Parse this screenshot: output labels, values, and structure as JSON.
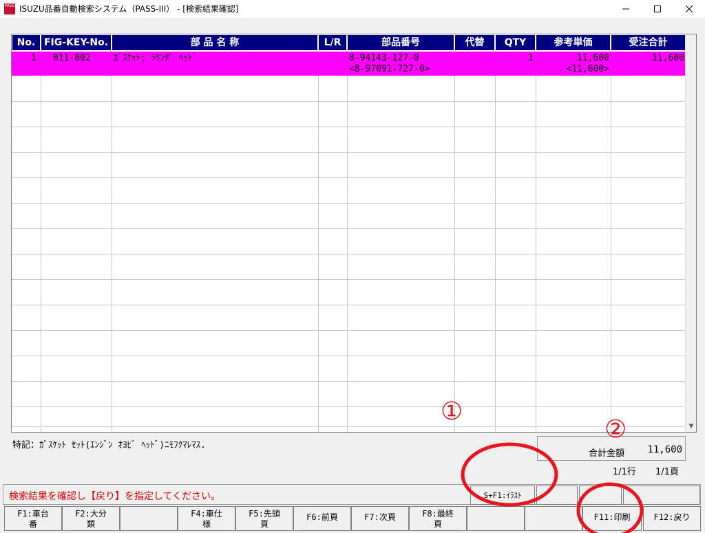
{
  "window": {
    "title": "ISUZU品番自動検索システム（PASS-III） - [検索結果確認]",
    "icon_label": "PASS"
  },
  "grid": {
    "columns": [
      "No.",
      "FIG-KEY-No.",
      "部 品 名 称",
      "L/R",
      "部品番号",
      "代替",
      "QTY",
      "参考単価",
      "受注合計"
    ],
    "rows": [
      {
        "no": "1",
        "fig_key": "011-002",
        "name": "ｶﾞｽｹｯﾄ; ｼﾘﾝﾀﾞ ﾍｯﾄﾞ",
        "lr": "",
        "part_no": "8-94143-127-0",
        "part_no_alt": "<8-97091-727-0>",
        "substitute": "",
        "qty": "1",
        "unit_price": "11,600",
        "unit_price_alt": "<11,600>",
        "order_total": "11,600"
      }
    ]
  },
  "note": "特記：ｶﾞｽｹｯﾄ ｾｯﾄ(ｴﾝｼﾞﾝ ｵﾖﾋﾞ ﾍｯﾄﾞ)ﾆﾓﾌｸﾏﾚﾏｽ.",
  "total": {
    "label": "合計金額",
    "value": "11,600"
  },
  "page_info": {
    "rows": "1/1行",
    "page": "1/1頁"
  },
  "message": "検索結果を確認し【戻り】を指定してください。",
  "shift_keys": {
    "s_f1": "S+F1:ｲﾗｽﾄ"
  },
  "fkeys": [
    {
      "id": "f1",
      "line1": "F1:車台",
      "line2": "番"
    },
    {
      "id": "f2",
      "line1": "F2:大分",
      "line2": "類"
    },
    {
      "id": "f3",
      "line1": "",
      "line2": ""
    },
    {
      "id": "f4",
      "line1": "F4:車仕",
      "line2": "様"
    },
    {
      "id": "f5",
      "line1": "F5:先頭",
      "line2": "頁"
    },
    {
      "id": "f6",
      "line1": "F6:前頁",
      "line2": ""
    },
    {
      "id": "f7",
      "line1": "F7:次頁",
      "line2": ""
    },
    {
      "id": "f8",
      "line1": "F8:最終",
      "line2": "頁"
    },
    {
      "id": "f9",
      "line1": "",
      "line2": ""
    },
    {
      "id": "f10",
      "line1": "",
      "line2": ""
    },
    {
      "id": "f11",
      "line1": "F11:印刷",
      "line2": ""
    },
    {
      "id": "f12",
      "line1": "F12:戻り",
      "line2": ""
    }
  ],
  "annotations": {
    "one": "①",
    "two": "②"
  },
  "colors": {
    "header_bg": "#000080",
    "selected_row": "#ff00ff",
    "message_text": "#e00000",
    "annotation": "#e8141e"
  }
}
